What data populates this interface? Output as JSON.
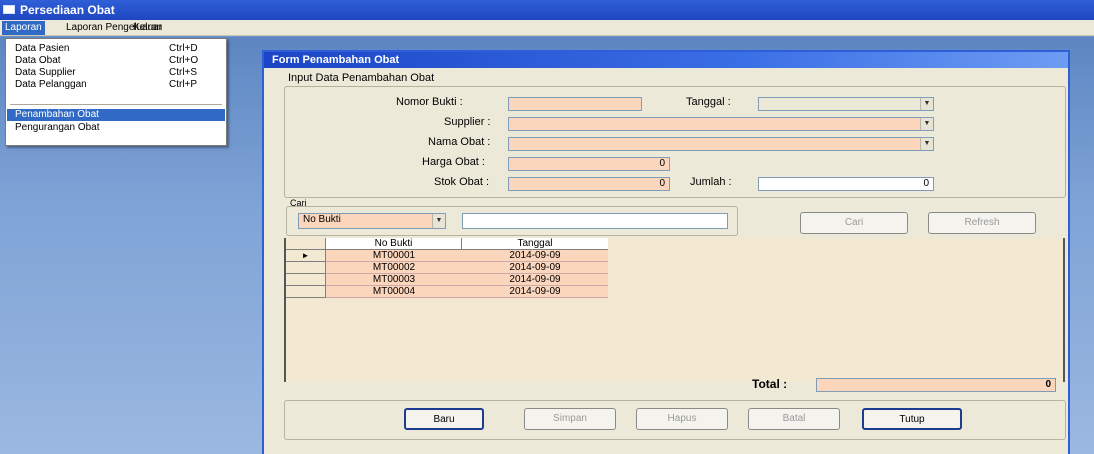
{
  "app": {
    "title": "Persediaan Obat"
  },
  "menubar": [
    {
      "label": "Laporan",
      "active": true
    },
    {
      "label": "Laporan Pengeluaran",
      "active": false
    },
    {
      "label": "Keluar",
      "active": false
    }
  ],
  "dropdown": {
    "items": [
      {
        "label": "Data Pasien",
        "shortcut": "Ctrl+D"
      },
      {
        "label": "Data Obat",
        "shortcut": "Ctrl+O"
      },
      {
        "label": "Data Supplier",
        "shortcut": "Ctrl+S"
      },
      {
        "label": "Data Pelanggan",
        "shortcut": "Ctrl+P"
      }
    ],
    "items2": [
      {
        "label": "Penambahan Obat",
        "selected": true
      },
      {
        "label": "Pengurangan Obat",
        "selected": false
      }
    ]
  },
  "form": {
    "title": "Form Penambahan Obat",
    "group_title": "Input Data Penambahan Obat",
    "labels": {
      "nomor_bukti": "Nomor Bukti :",
      "tanggal": "Tanggal :",
      "supplier": "Supplier :",
      "nama_obat": "Nama Obat :",
      "harga_obat": "Harga Obat :",
      "stok_obat": "Stok Obat :",
      "jumlah": "Jumlah :"
    },
    "values": {
      "nomor_bukti": "",
      "tanggal": "",
      "supplier": "",
      "nama_obat": "",
      "harga_obat": "0",
      "stok_obat": "0",
      "jumlah": "0"
    },
    "cari": {
      "label": "Cari",
      "select_value": "No Bukti",
      "text_value": ""
    },
    "buttons_mid": {
      "cari": "Cari",
      "refresh": "Refresh"
    },
    "grid": {
      "columns": [
        "No Bukti",
        "Tanggal"
      ],
      "rows": [
        {
          "no": "MT00001",
          "tgl": "2014-09-09"
        },
        {
          "no": "MT00002",
          "tgl": "2014-09-09"
        },
        {
          "no": "MT00003",
          "tgl": "2014-09-09"
        },
        {
          "no": "MT00004",
          "tgl": "2014-09-09"
        }
      ],
      "current_marker": "►"
    },
    "total": {
      "label": "Total :",
      "value": "0"
    },
    "buttons": {
      "baru": "Baru",
      "simpan": "Simpan",
      "hapus": "Hapus",
      "batal": "Batal",
      "tutup": "Tutup"
    }
  },
  "colors": {
    "accent": "#316ac5",
    "field": "#fbd6bc",
    "window_bg": "#ece9d8"
  },
  "icons": {
    "dropdown": "chevron-down-icon",
    "row_indicator": "triangle-right-icon"
  }
}
